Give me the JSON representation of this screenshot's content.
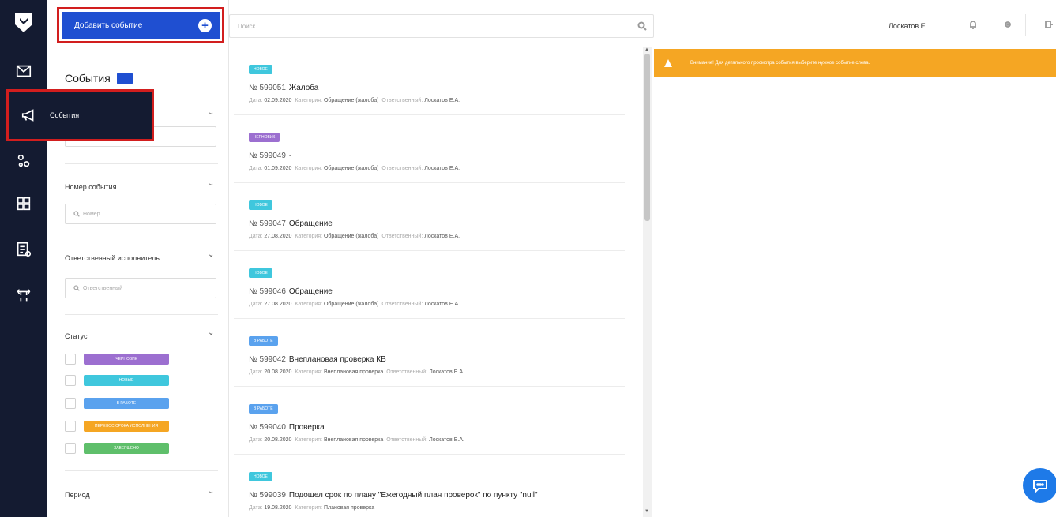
{
  "rail": {
    "items": [
      {
        "icon": "envelope-icon"
      },
      {
        "icon": "megaphone-icon"
      },
      {
        "icon": "settings-gears-icon"
      },
      {
        "icon": "grid-apps-icon"
      },
      {
        "icon": "report-icon"
      },
      {
        "icon": "hierarchy-icon"
      }
    ],
    "flyout_label": "События"
  },
  "filters": {
    "add_button_label": "Добавить событие",
    "title": "События",
    "event_number_label": "Номер события",
    "event_number_placeholder": "Номер...",
    "responsible_label": "Ответственный исполнитель",
    "responsible_placeholder": "Ответственный",
    "status_label": "Статус",
    "statuses": [
      {
        "label": "ЧЕРНОВИК",
        "color": "#9c6fd0"
      },
      {
        "label": "НОВЫЕ",
        "color": "#3fc7dd"
      },
      {
        "label": "В РАБОТЕ",
        "color": "#5aa2ee"
      },
      {
        "label": "ПЕРЕНОС СРОКА ИСПОЛНЕНИЯ",
        "color": "#f5a623"
      },
      {
        "label": "ЗАВЕРШЕНО",
        "color": "#5fbf6b"
      }
    ],
    "period_label": "Период"
  },
  "search": {
    "placeholder": "Поиск..."
  },
  "events": [
    {
      "badge": "НОВОЕ",
      "badge_color": "#3fc7dd",
      "number": "№ 599051",
      "title": "Жалоба",
      "date_key": "Дата:",
      "date": "02.09.2020",
      "cat_key": "Категория:",
      "category": "Обращение (жалоба)",
      "resp_key": "Ответственный:",
      "responsible": "Лоскатов Е.А."
    },
    {
      "badge": "ЧЕРНОВИК",
      "badge_color": "#9c6fd0",
      "number": "№ 599049",
      "title": "-",
      "date_key": "Дата:",
      "date": "01.09.2020",
      "cat_key": "Категория:",
      "category": "Обращение (жалоба)",
      "resp_key": "Ответственный:",
      "responsible": "Лоскатов Е.А."
    },
    {
      "badge": "НОВОЕ",
      "badge_color": "#3fc7dd",
      "number": "№ 599047",
      "title": "Обращение",
      "date_key": "Дата:",
      "date": "27.08.2020",
      "cat_key": "Категория:",
      "category": "Обращение (жалоба)",
      "resp_key": "Ответственный:",
      "responsible": "Лоскатов Е.А."
    },
    {
      "badge": "НОВОЕ",
      "badge_color": "#3fc7dd",
      "number": "№ 599046",
      "title": "Обращение",
      "date_key": "Дата:",
      "date": "27.08.2020",
      "cat_key": "Категория:",
      "category": "Обращение (жалоба)",
      "resp_key": "Ответственный:",
      "responsible": "Лоскатов Е.А."
    },
    {
      "badge": "В РАБОТЕ",
      "badge_color": "#5aa2ee",
      "number": "№ 599042",
      "title": "Внеплановая проверка КВ",
      "date_key": "Дата:",
      "date": "20.08.2020",
      "cat_key": "Категория:",
      "category": "Внеплановая проверка",
      "resp_key": "Ответственный:",
      "responsible": "Лоскатов Е.А."
    },
    {
      "badge": "В РАБОТЕ",
      "badge_color": "#5aa2ee",
      "number": "№ 599040",
      "title": "Проверка",
      "date_key": "Дата:",
      "date": "20.08.2020",
      "cat_key": "Категория:",
      "category": "Внеплановая проверка",
      "resp_key": "Ответственный:",
      "responsible": "Лоскатов Е.А."
    },
    {
      "badge": "НОВОЕ",
      "badge_color": "#3fc7dd",
      "number": "№ 599039",
      "title": "Подошел срок по плану \"Ежегодный план проверок\" по пункту \"null\"",
      "date_key": "Дата:",
      "date": "19.08.2020",
      "cat_key": "Категория:",
      "category": "Плановая проверка",
      "resp_key": "",
      "responsible": ""
    }
  ],
  "header": {
    "user_name": "Лоскатов Е."
  },
  "alert": {
    "text": "Внимание! Для детального просмотра события выберите нужное событие слева."
  }
}
